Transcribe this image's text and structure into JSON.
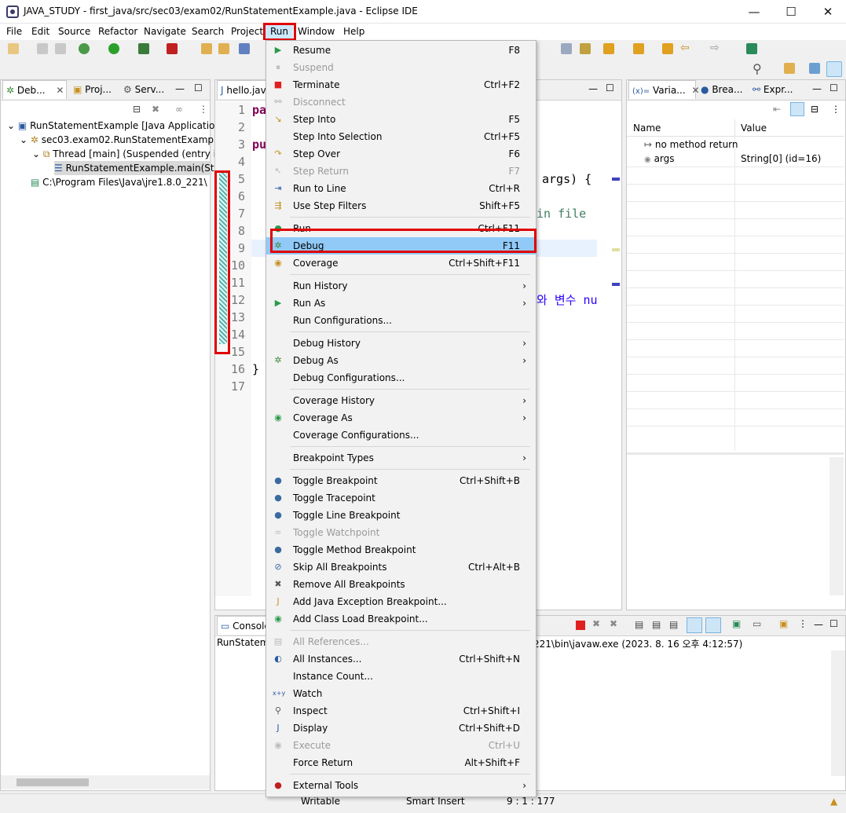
{
  "window": {
    "title": "JAVA_STUDY - first_java/src/sec03/exam02/RunStatementExample.java - Eclipse IDE",
    "minimize": "—",
    "maximize": "☐",
    "close": "✕"
  },
  "menubar": [
    "File",
    "Edit",
    "Source",
    "Refactor",
    "Navigate",
    "Search",
    "Project",
    "Run",
    "Window",
    "Help"
  ],
  "debug_view": {
    "tabs": [
      "Deb...",
      "Proj...",
      "Serv..."
    ],
    "tree": [
      "RunStatementExample [Java Application]",
      "sec03.exam02.RunStatementExample",
      "Thread [main] (Suspended (entry in",
      "RunStatementExample.main(Stri",
      "C:\\Program Files\\Java\\jre1.8.0_221\\"
    ]
  },
  "editor": {
    "tab": "hello.java",
    "line_numbers": [
      "1",
      "2",
      "3",
      "4",
      "5",
      "6",
      "7",
      "8",
      "9",
      "10",
      "11",
      "12",
      "13",
      "14",
      "15",
      "16",
      "17"
    ],
    "line1": "pa",
    "line3": "pu",
    "line5": "args) {",
    "line7": "in file",
    "line12": "와 변수 nu",
    "line16": "}"
  },
  "variables_view": {
    "tabs": [
      "Varia...",
      "Brea...",
      "Expr..."
    ],
    "columns": [
      "Name",
      "Value"
    ],
    "rows": [
      {
        "name": "no method return",
        "value": ""
      },
      {
        "name": "args",
        "value": "String[0]  (id=16)"
      }
    ]
  },
  "console": {
    "tab": "Console",
    "header_left": "RunStateme",
    "header_right": "221\\bin\\javaw.exe  (2023. 8. 16 오후 4:12:57)"
  },
  "run_menu": {
    "items": [
      {
        "label": "Resume",
        "accel": "F8",
        "disabled": false,
        "icon": "resume-icon"
      },
      {
        "label": "Suspend",
        "accel": "",
        "disabled": true,
        "icon": "suspend-icon"
      },
      {
        "label": "Terminate",
        "accel": "Ctrl+F2",
        "disabled": false,
        "icon": "terminate-icon"
      },
      {
        "label": "Disconnect",
        "accel": "",
        "disabled": true,
        "icon": "disconnect-icon"
      },
      {
        "label": "Step Into",
        "accel": "F5",
        "disabled": false,
        "icon": "step-into-icon"
      },
      {
        "label": "Step Into Selection",
        "accel": "Ctrl+F5",
        "disabled": false,
        "icon": ""
      },
      {
        "label": "Step Over",
        "accel": "F6",
        "disabled": false,
        "icon": "step-over-icon"
      },
      {
        "label": "Step Return",
        "accel": "F7",
        "disabled": true,
        "icon": "step-return-icon"
      },
      {
        "label": "Run to Line",
        "accel": "Ctrl+R",
        "disabled": false,
        "icon": "run-to-line-icon"
      },
      {
        "label": "Use Step Filters",
        "accel": "Shift+F5",
        "disabled": false,
        "icon": "step-filters-icon"
      },
      {
        "label": "Run",
        "accel": "Ctrl+F11",
        "disabled": false,
        "icon": "run-icon"
      },
      {
        "label": "Debug",
        "accel": "F11",
        "disabled": false,
        "icon": "debug-icon"
      },
      {
        "label": "Coverage",
        "accel": "Ctrl+Shift+F11",
        "disabled": false,
        "icon": "coverage-icon"
      },
      {
        "label": "Run History",
        "accel": "",
        "disabled": false,
        "icon": ""
      },
      {
        "label": "Run As",
        "accel": "",
        "disabled": false,
        "icon": "run-as-icon"
      },
      {
        "label": "Run Configurations...",
        "accel": "",
        "disabled": false,
        "icon": ""
      },
      {
        "label": "Debug History",
        "accel": "",
        "disabled": false,
        "icon": ""
      },
      {
        "label": "Debug As",
        "accel": "",
        "disabled": false,
        "icon": "debug-as-icon"
      },
      {
        "label": "Debug Configurations...",
        "accel": "",
        "disabled": false,
        "icon": ""
      },
      {
        "label": "Coverage History",
        "accel": "",
        "disabled": false,
        "icon": ""
      },
      {
        "label": "Coverage As",
        "accel": "",
        "disabled": false,
        "icon": "coverage-as-icon"
      },
      {
        "label": "Coverage Configurations...",
        "accel": "",
        "disabled": false,
        "icon": ""
      },
      {
        "label": "Breakpoint Types",
        "accel": "",
        "disabled": false,
        "icon": ""
      },
      {
        "label": "Toggle Breakpoint",
        "accel": "Ctrl+Shift+B",
        "disabled": false,
        "icon": "breakpoint-dot-icon"
      },
      {
        "label": "Toggle Tracepoint",
        "accel": "",
        "disabled": false,
        "icon": "tracepoint-dot-icon"
      },
      {
        "label": "Toggle Line Breakpoint",
        "accel": "",
        "disabled": false,
        "icon": "line-breakpoint-dot-icon"
      },
      {
        "label": "Toggle Watchpoint",
        "accel": "",
        "disabled": true,
        "icon": "watchpoint-icon"
      },
      {
        "label": "Toggle Method Breakpoint",
        "accel": "",
        "disabled": false,
        "icon": "method-breakpoint-dot-icon"
      },
      {
        "label": "Skip All Breakpoints",
        "accel": "Ctrl+Alt+B",
        "disabled": false,
        "icon": "skip-breakpoints-icon"
      },
      {
        "label": "Remove All Breakpoints",
        "accel": "",
        "disabled": false,
        "icon": "remove-breakpoints-icon"
      },
      {
        "label": "Add Java Exception Breakpoint...",
        "accel": "",
        "disabled": false,
        "icon": "exception-breakpoint-icon"
      },
      {
        "label": "Add Class Load Breakpoint...",
        "accel": "",
        "disabled": false,
        "icon": "class-load-breakpoint-icon"
      },
      {
        "label": "All References...",
        "accel": "",
        "disabled": true,
        "icon": "references-icon"
      },
      {
        "label": "All Instances...",
        "accel": "Ctrl+Shift+N",
        "disabled": false,
        "icon": "instances-icon"
      },
      {
        "label": "Instance Count...",
        "accel": "",
        "disabled": false,
        "icon": ""
      },
      {
        "label": "Watch",
        "accel": "",
        "disabled": false,
        "icon": "watch-icon"
      },
      {
        "label": "Inspect",
        "accel": "Ctrl+Shift+I",
        "disabled": false,
        "icon": "inspect-icon"
      },
      {
        "label": "Display",
        "accel": "Ctrl+Shift+D",
        "disabled": false,
        "icon": "display-icon"
      },
      {
        "label": "Execute",
        "accel": "Ctrl+U",
        "disabled": true,
        "icon": "execute-icon"
      },
      {
        "label": "Force Return",
        "accel": "Alt+Shift+F",
        "disabled": false,
        "icon": ""
      },
      {
        "label": "External Tools",
        "accel": "",
        "disabled": false,
        "icon": "external-tools-icon"
      }
    ],
    "submenu_arrow": "›"
  },
  "statusbar": {
    "writable": "Writable",
    "insert_mode": "Smart Insert",
    "position": "9 : 1 : 177"
  },
  "colors": {
    "highlight_red": "#e00000",
    "menu_selection": "#91c9f7",
    "keyword": "#7f0055",
    "comment": "#3f7f5f"
  }
}
